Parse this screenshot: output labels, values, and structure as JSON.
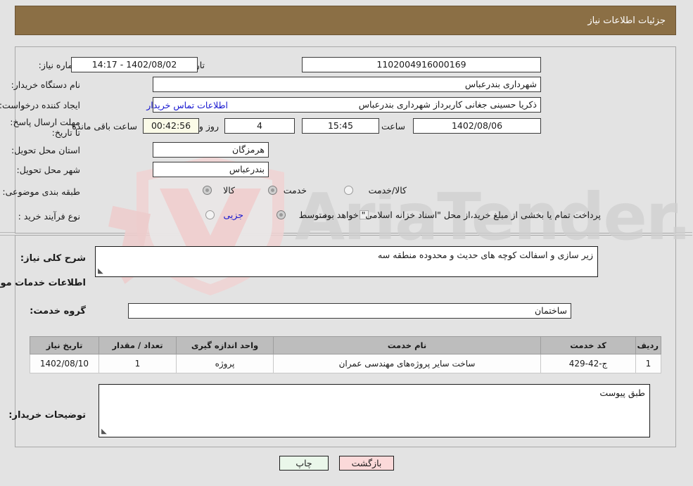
{
  "header": {
    "title": "جزئیات اطلاعات نیاز"
  },
  "top_section": {
    "need_number_label": "شماره نیاز:",
    "need_number_value": "1102004916000169",
    "announce_datetime_label": "تاریخ و ساعت اعلان عمومی:",
    "announce_datetime_value": "1402/08/02 - 14:17",
    "buyer_org_label": "نام دستگاه خریدار:",
    "buyer_org_value": "شهرداری بندرعباس",
    "creator_label": "ایجاد کننده درخواست:",
    "creator_value": "ذکریا حسینی جغانی کاربرداز شهرداری بندرعباس",
    "contact_link": "اطلاعات تماس خریدار",
    "deadline_label": "مهلت ارسال پاسخ: تا تاریخ:",
    "deadline_date": "1402/08/06",
    "hour_label": "ساعت",
    "deadline_time": "15:45",
    "days_value": "4",
    "days_label": "روز و",
    "timer_value": "00:42:56",
    "remaining_label": "ساعت باقی مانده",
    "province_label": "استان محل تحویل:",
    "province_value": "هرمزگان",
    "city_label": "شهر محل تحویل:",
    "city_value": "بندرعباس",
    "category_label": "طبقه بندی موضوعی:",
    "category_options": [
      {
        "label": "کالا",
        "selected": false
      },
      {
        "label": "خدمت",
        "selected": true
      },
      {
        "label": "کالا/خدمت",
        "selected": false
      }
    ],
    "process_label": "نوع فرآیند خرید :",
    "process_options": [
      {
        "label": "جزیی",
        "selected": false
      },
      {
        "label": "متوسط",
        "selected": true
      }
    ],
    "treasury_checkbox_label": "پرداخت تمام یا بخشی از مبلغ خرید،از محل \"اسناد خزانه اسلامی\" خواهد بود."
  },
  "mid_section": {
    "general_desc_label": "شرح کلی نیاز:",
    "general_desc_value": "زیر سازی و اسفالت کوچه های حدیث و محدوده منطقه سه",
    "services_heading": "اطلاعات خدمات مورد نیاز",
    "service_group_label": "گروه خدمت:",
    "service_group_value": "ساختمان",
    "table": {
      "columns": [
        "ردیف",
        "کد خدمت",
        "نام خدمت",
        "واحد اندازه گیری",
        "تعداد / مقدار",
        "تاریخ نیاز"
      ],
      "rows": [
        [
          "1",
          "ج-42-429",
          "ساخت سایر پروژه‌های مهندسی عمران",
          "پروژه",
          "1",
          "1402/08/10"
        ]
      ]
    },
    "buyer_notes_label": "توضیحات خریدار:",
    "buyer_notes_value": "طبق پیوست"
  },
  "footer": {
    "print_label": "چاپ",
    "back_label": "بازگشت"
  },
  "watermark": {
    "text": "AriaTender.net"
  }
}
